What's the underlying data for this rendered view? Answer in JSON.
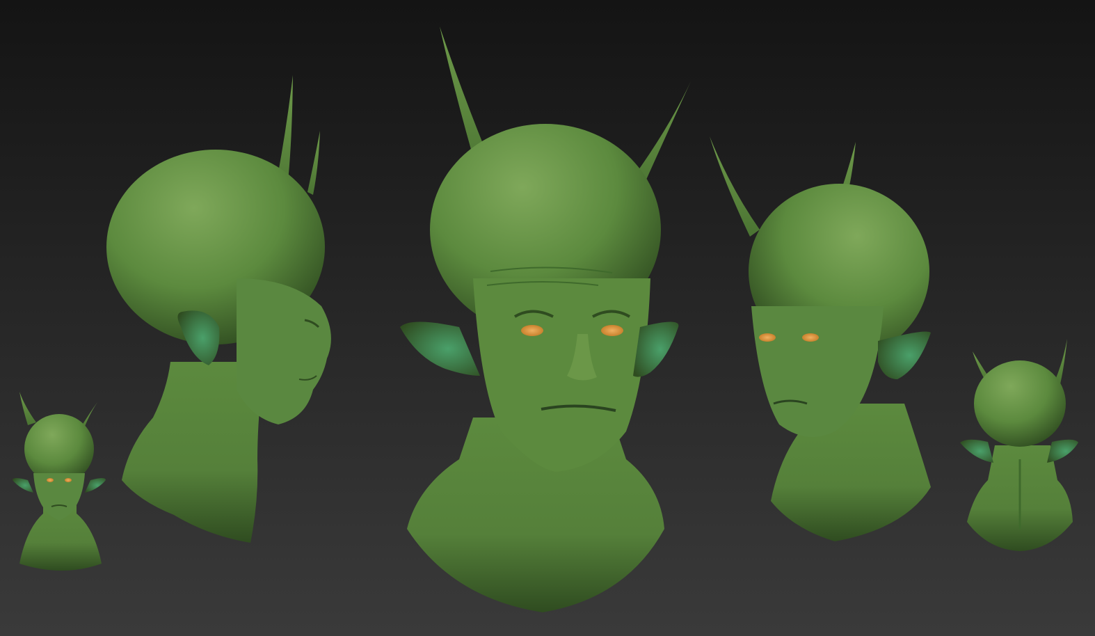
{
  "scene": {
    "background": {
      "top": "#141414",
      "bottom": "#3a3a3a"
    },
    "palette": {
      "skin_highlight": "#7fa85a",
      "skin_mid": "#5c8a3e",
      "skin_shadow": "#2f4c20",
      "skin_deep": "#1e3215",
      "ear_inner": "#4aa06a",
      "eye": "#c9822e",
      "spike": "#6e9a4a"
    },
    "views": [
      {
        "name": "front-small",
        "view": "front"
      },
      {
        "name": "profile-right",
        "view": "side"
      },
      {
        "name": "front-main",
        "view": "front"
      },
      {
        "name": "three-quarter-left",
        "view": "three-quarter"
      },
      {
        "name": "back",
        "view": "back"
      }
    ]
  }
}
